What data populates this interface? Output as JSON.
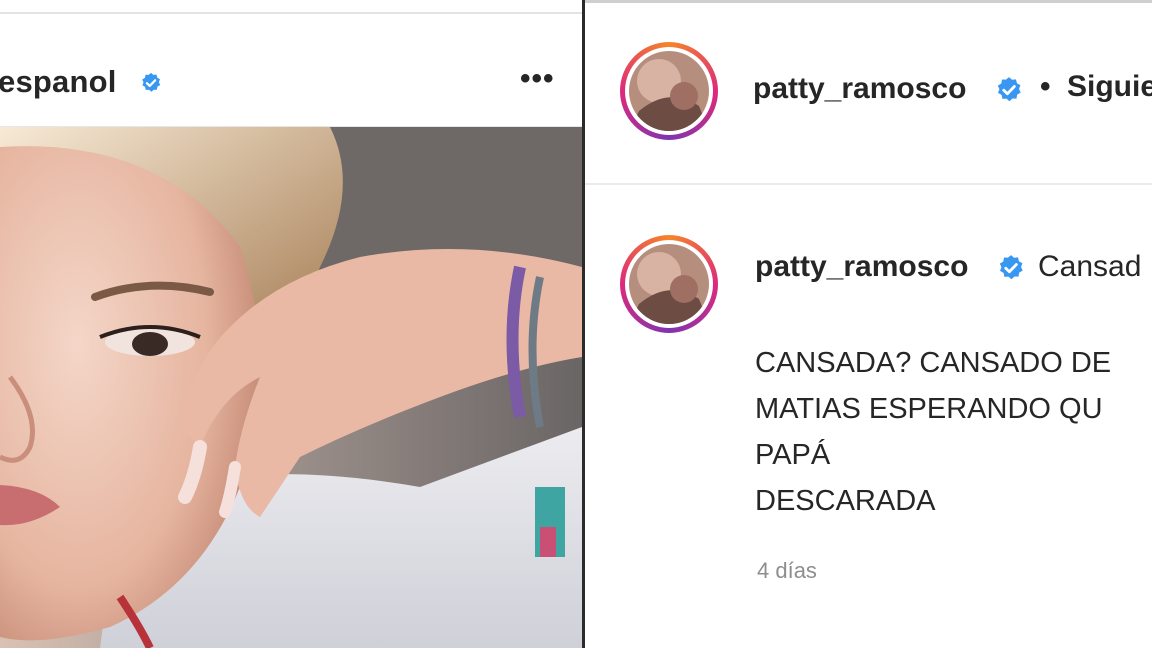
{
  "left_post": {
    "account_name": "espanol",
    "more_label": "•••"
  },
  "right_post": {
    "header": {
      "username": "patty_ramosco",
      "separator": "•",
      "follow_label": "Siguie"
    },
    "comment": {
      "username": "patty_ramosco",
      "text": "Cansad",
      "caption_lines": [
        "CANSADA? CANSADO DE",
        "MATIAS ESPERANDO QU",
        "PAPÁ",
        "DESCARADA"
      ],
      "timestamp": "4 días"
    }
  },
  "colors": {
    "verified": "#3897f0",
    "ring_start": "#f58529",
    "ring_end": "#8134af"
  }
}
